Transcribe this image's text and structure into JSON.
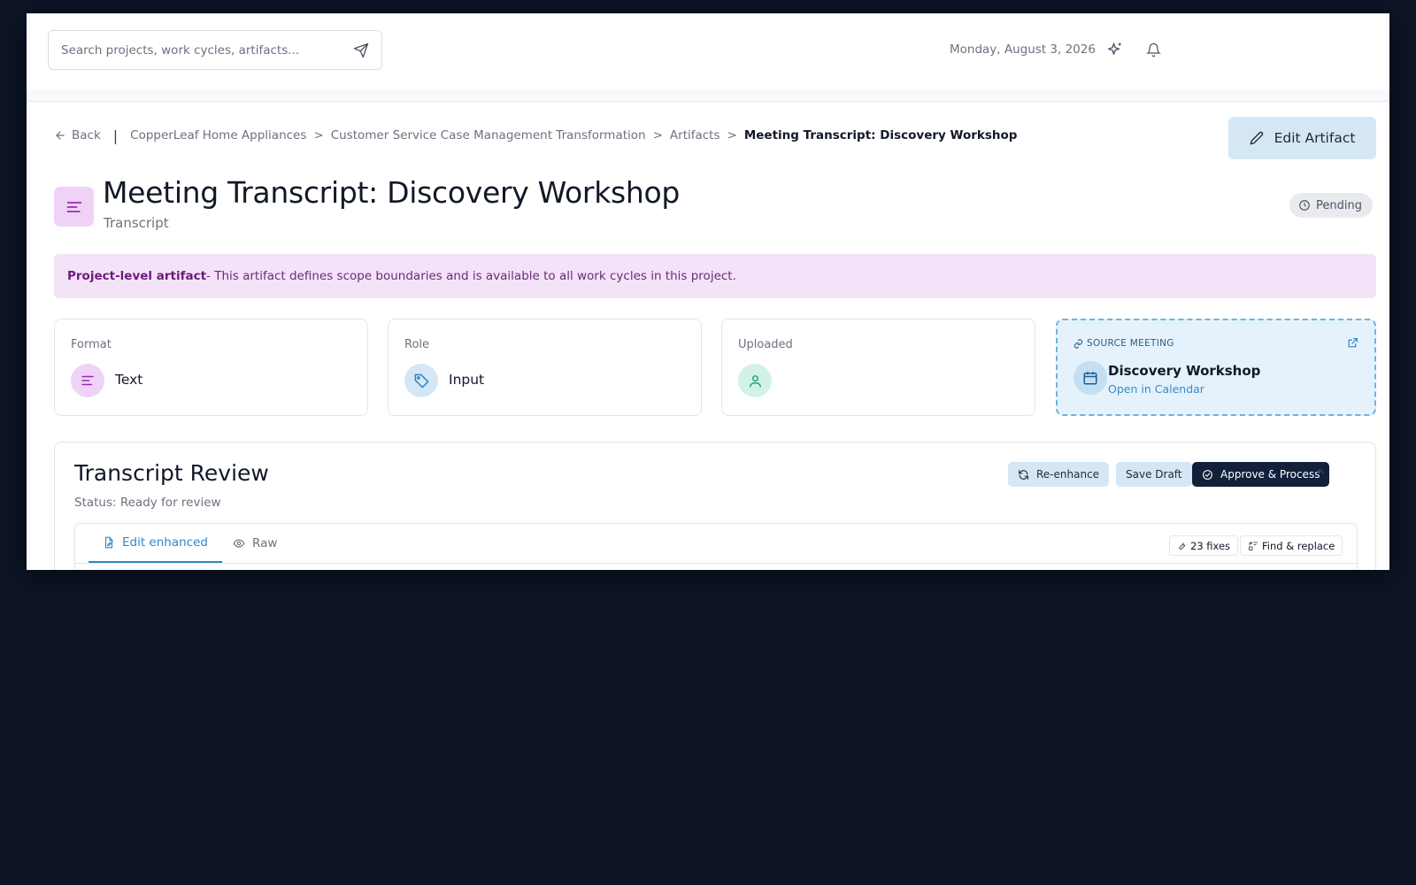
{
  "header": {
    "search_placeholder": "Search projects, work cycles, artifacts...",
    "date": "Monday, August 3, 2026"
  },
  "breadcrumb": {
    "back": "Back",
    "items": [
      "CopperLeaf Home Appliances",
      "Customer Service Case Management Transformation",
      "Artifacts"
    ],
    "current": "Meeting Transcript: Discovery Workshop"
  },
  "actions": {
    "edit_artifact": "Edit Artifact"
  },
  "artifact": {
    "title": "Meeting Transcript: Discovery Workshop",
    "type": "Transcript",
    "status": "Pending"
  },
  "notice": {
    "bold": "Project-level artifact",
    "text": " - This artifact defines scope boundaries and is available to all work cycles in this project."
  },
  "cards": {
    "format": {
      "label": "Format",
      "value": "Text"
    },
    "role": {
      "label": "Role",
      "value": "Input"
    },
    "uploaded": {
      "label": "Uploaded"
    },
    "source": {
      "label": "SOURCE MEETING",
      "name": "Discovery Workshop",
      "link": "Open in Calendar"
    }
  },
  "review": {
    "title": "Transcript Review",
    "status": "Status: Ready for review",
    "re_enhance": "Re-enhance",
    "save_draft": "Save Draft",
    "approve": "Approve & Process",
    "tabs": [
      "Edit enhanced",
      "Raw"
    ],
    "fixes": "23 fixes",
    "find_replace": "Find & replace"
  },
  "colors": {
    "accent_blue": "#2f86c6",
    "purple_bg": "#f4e3f8",
    "dark_navy": "#13203c",
    "page_bg": "#0c1426"
  }
}
